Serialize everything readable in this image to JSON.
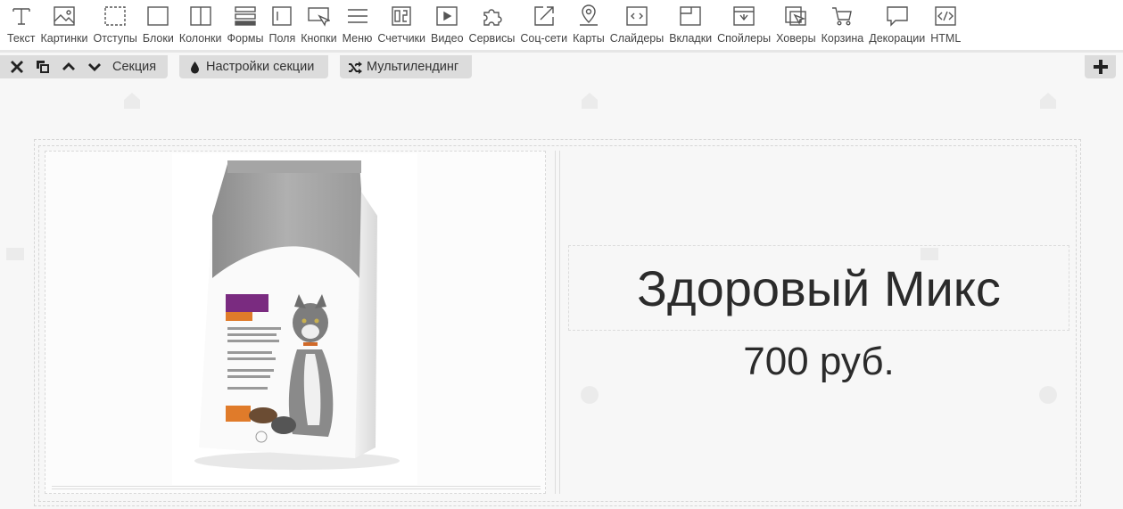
{
  "toolbar": {
    "items": [
      {
        "label": "Текст",
        "icon": "text-icon"
      },
      {
        "label": "Картинки",
        "icon": "image-icon"
      },
      {
        "label": "Отступы",
        "icon": "spacing-icon"
      },
      {
        "label": "Блоки",
        "icon": "block-icon"
      },
      {
        "label": "Колонки",
        "icon": "columns-icon"
      },
      {
        "label": "Формы",
        "icon": "forms-icon"
      },
      {
        "label": "Поля",
        "icon": "fields-icon"
      },
      {
        "label": "Кнопки",
        "icon": "buttons-icon"
      },
      {
        "label": "Меню",
        "icon": "menu-icon"
      },
      {
        "label": "Счетчики",
        "icon": "counters-icon"
      },
      {
        "label": "Видео",
        "icon": "video-icon"
      },
      {
        "label": "Сервисы",
        "icon": "services-icon"
      },
      {
        "label": "Соц-сети",
        "icon": "social-icon"
      },
      {
        "label": "Карты",
        "icon": "map-icon"
      },
      {
        "label": "Слайдеры",
        "icon": "slider-icon"
      },
      {
        "label": "Вкладки",
        "icon": "tabs-icon"
      },
      {
        "label": "Спойлеры",
        "icon": "spoiler-icon"
      },
      {
        "label": "Ховеры",
        "icon": "hover-icon"
      },
      {
        "label": "Корзина",
        "icon": "cart-icon"
      },
      {
        "label": "Декорации",
        "icon": "decoration-icon"
      },
      {
        "label": "HTML",
        "icon": "html-icon"
      }
    ]
  },
  "section_bar": {
    "section_label": "Секция",
    "settings_label": "Настройки секции",
    "multilanding_label": "Мультилендинг"
  },
  "product": {
    "title": "Здоровый Микс",
    "price": "700 руб.",
    "image_icon": "cat-food-bag-image"
  },
  "colors": {
    "toolbar_bg": "#ffffff",
    "bar_bg": "#dcdcdc",
    "page_bg": "#f7f7f7",
    "text": "#2b2b2b"
  }
}
